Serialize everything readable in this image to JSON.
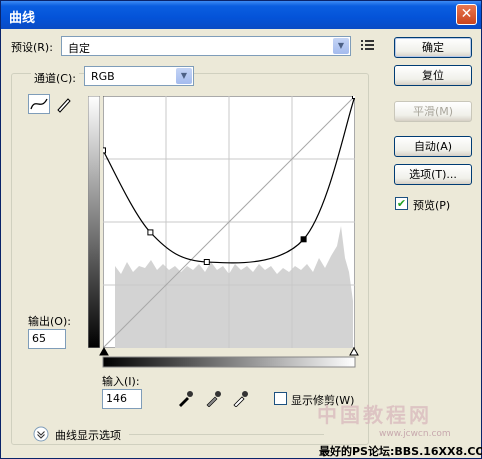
{
  "window": {
    "title": "曲线",
    "close_glyph": "✕"
  },
  "preset": {
    "label": "预设(R):",
    "value": "自定",
    "menu_icon": "preset-options-icon"
  },
  "channel": {
    "label": "通道(C):",
    "value": "RGB"
  },
  "buttons": {
    "ok": "确定",
    "reset": "复位",
    "smooth": "平滑(M)",
    "auto": "自动(A)",
    "options": "选项(T)..."
  },
  "preview": {
    "label": "预览(P)",
    "checked": true
  },
  "output": {
    "label": "输出(O):",
    "value": "65"
  },
  "input": {
    "label": "输入(I):",
    "value": "146"
  },
  "show_clipping": {
    "label": "显示修剪(W)",
    "checked": false
  },
  "display_options": {
    "label": "曲线显示选项"
  },
  "curve_points": [
    [
      0,
      200
    ],
    [
      48,
      117
    ],
    [
      105,
      87
    ],
    [
      203,
      110
    ],
    [
      255,
      255
    ]
  ],
  "selected_point": 3,
  "watermark": {
    "line1": "中国教程网",
    "line2": "最好的PS论坛:BBS.16XX8.COM",
    "line3": "www.jcwcn.com"
  },
  "colors": {
    "accent": "#0a5ee0",
    "curve": "#000000",
    "histogram": "#cfcfcf"
  }
}
